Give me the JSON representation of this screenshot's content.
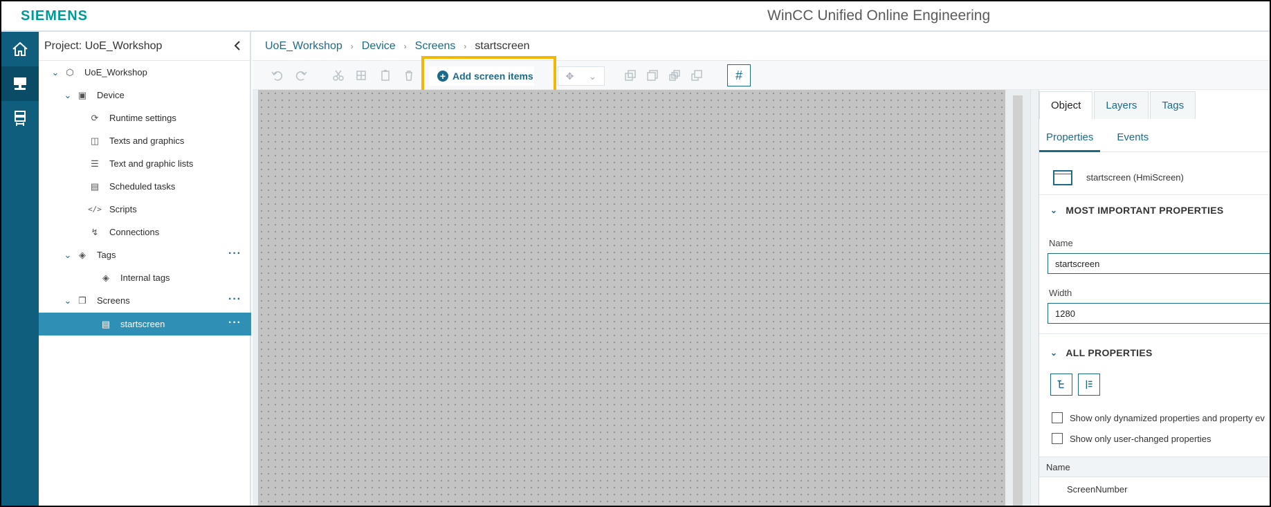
{
  "header": {
    "logo": "SIEMENS",
    "title": "WinCC Unified Online Engineering"
  },
  "rail": {
    "items": [
      {
        "icon": "home-icon"
      },
      {
        "icon": "device-icon",
        "active": true
      },
      {
        "icon": "library-icon"
      }
    ]
  },
  "project_tree": {
    "title": "Project: UoE_Workshop",
    "items": [
      {
        "label": "UoE_Workshop",
        "icon": "cube-icon",
        "expanded": true
      },
      {
        "label": "Device",
        "icon": "monitor-icon",
        "expanded": true
      },
      {
        "label": "Runtime settings",
        "icon": "runtime-settings-icon"
      },
      {
        "label": "Texts and graphics",
        "icon": "texts-graphics-icon"
      },
      {
        "label": "Text and graphic lists",
        "icon": "list-icon"
      },
      {
        "label": "Scheduled tasks",
        "icon": "calendar-icon"
      },
      {
        "label": "Scripts",
        "icon": "code-icon"
      },
      {
        "label": "Connections",
        "icon": "connection-icon"
      },
      {
        "label": "Tags",
        "icon": "tag-icon",
        "expanded": true,
        "more": "···"
      },
      {
        "label": "Internal tags",
        "icon": "internal-tag-icon"
      },
      {
        "label": "Screens",
        "icon": "screens-icon",
        "expanded": true,
        "more": "···"
      },
      {
        "label": "startscreen",
        "icon": "screen-icon",
        "selected": true,
        "more": "···"
      }
    ]
  },
  "breadcrumb": [
    "UoE_Workshop",
    "Device",
    "Screens",
    "startscreen"
  ],
  "toolbar": {
    "add_screen_items": "Add screen items",
    "grid_glyph": "#"
  },
  "properties": {
    "tabs": [
      "Object",
      "Layers",
      "Tags"
    ],
    "subtabs": [
      "Properties",
      "Events"
    ],
    "object_name": "startscreen (HmiScreen)",
    "most_important_header": "MOST IMPORTANT PROPERTIES",
    "name_label": "Name",
    "name_value": "startscreen",
    "width_label": "Width",
    "width_value": "1280",
    "all_properties_header": "ALL PROPERTIES",
    "checkbox_dynamized": "Show only dynamized properties and property ev",
    "checkbox_user_changed": "Show only user-changed properties",
    "table_header_name": "Name",
    "first_row": "ScreenNumber"
  },
  "colors": {
    "brand": "#009999",
    "rail": "#0f5e7d",
    "accent": "#1c6a8a",
    "selection": "#2f8fb5",
    "highlight": "#f2b705"
  }
}
